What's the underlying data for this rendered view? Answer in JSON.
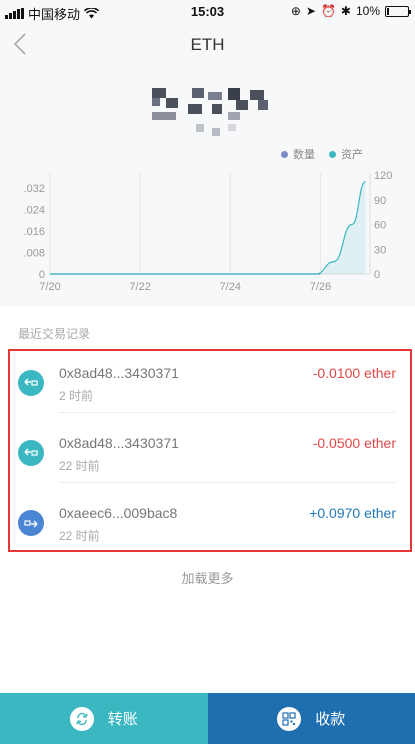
{
  "status_bar": {
    "carrier": "中国移动",
    "time": "15:03",
    "battery": "10%",
    "battery_level": 0.1
  },
  "nav": {
    "title": "ETH",
    "back_icon": "chevron-left-icon"
  },
  "legend": [
    {
      "label": "数量",
      "color": "#7c8ac4"
    },
    {
      "label": "资产",
      "color": "#3bb7c2"
    }
  ],
  "chart_data": {
    "type": "line",
    "x_ticks": [
      "7/20",
      "7/22",
      "7/24",
      "7/26"
    ],
    "y_left_ticks": [
      ".032",
      ".024",
      ".016",
      ".008",
      "0"
    ],
    "y_right_ticks": [
      "120",
      "90",
      "60",
      "30",
      "0"
    ],
    "ylim_left": [
      0,
      0.036
    ],
    "ylim_right": [
      0,
      120
    ],
    "grid": true,
    "series": [
      {
        "axis": "left",
        "color": "#7c8ac4",
        "x": [
          "7/20",
          "7/21",
          "7/22",
          "7/23",
          "7/24",
          "7/25",
          "7/26"
        ],
        "y": [
          0,
          0,
          0,
          0,
          0,
          0,
          0
        ]
      },
      {
        "axis": "right",
        "color": "#3bb7c2",
        "fill": true,
        "x": [
          "7/20",
          "7/21",
          "7/22",
          "7/23",
          "7/24",
          "7/25",
          "7/25.9",
          "7/26.3",
          "7/26.7",
          "7/27"
        ],
        "y": [
          0,
          0,
          0,
          0,
          0,
          0,
          0,
          15,
          60,
          112
        ]
      }
    ]
  },
  "recent": {
    "title": "最近交易记录",
    "transactions": [
      {
        "address": "0x8ad48...3430371",
        "time": "2 时前",
        "amount": "-0.0100 ether",
        "direction": "out",
        "amount_color": "#e04848",
        "icon_color": "#3bb7c2",
        "icon": "send-arrow-icon"
      },
      {
        "address": "0x8ad48...3430371",
        "time": "22 时前",
        "amount": "-0.0500 ether",
        "direction": "out",
        "amount_color": "#e04848",
        "icon_color": "#3bb7c2",
        "icon": "send-arrow-icon"
      },
      {
        "address": "0xaeec6...009bac8",
        "time": "22 时前",
        "amount": "+0.0970 ether",
        "direction": "in",
        "amount_color": "#1f7bb8",
        "icon_color": "#4a86d4",
        "icon": "receive-arrow-icon"
      }
    ],
    "load_more": "加载更多"
  },
  "bottom": {
    "transfer": {
      "label": "转账",
      "color": "#3bb7c2",
      "icon": "transfer-icon"
    },
    "receive": {
      "label": "收款",
      "color": "#1f6fb0",
      "icon": "qr-code-icon"
    }
  }
}
